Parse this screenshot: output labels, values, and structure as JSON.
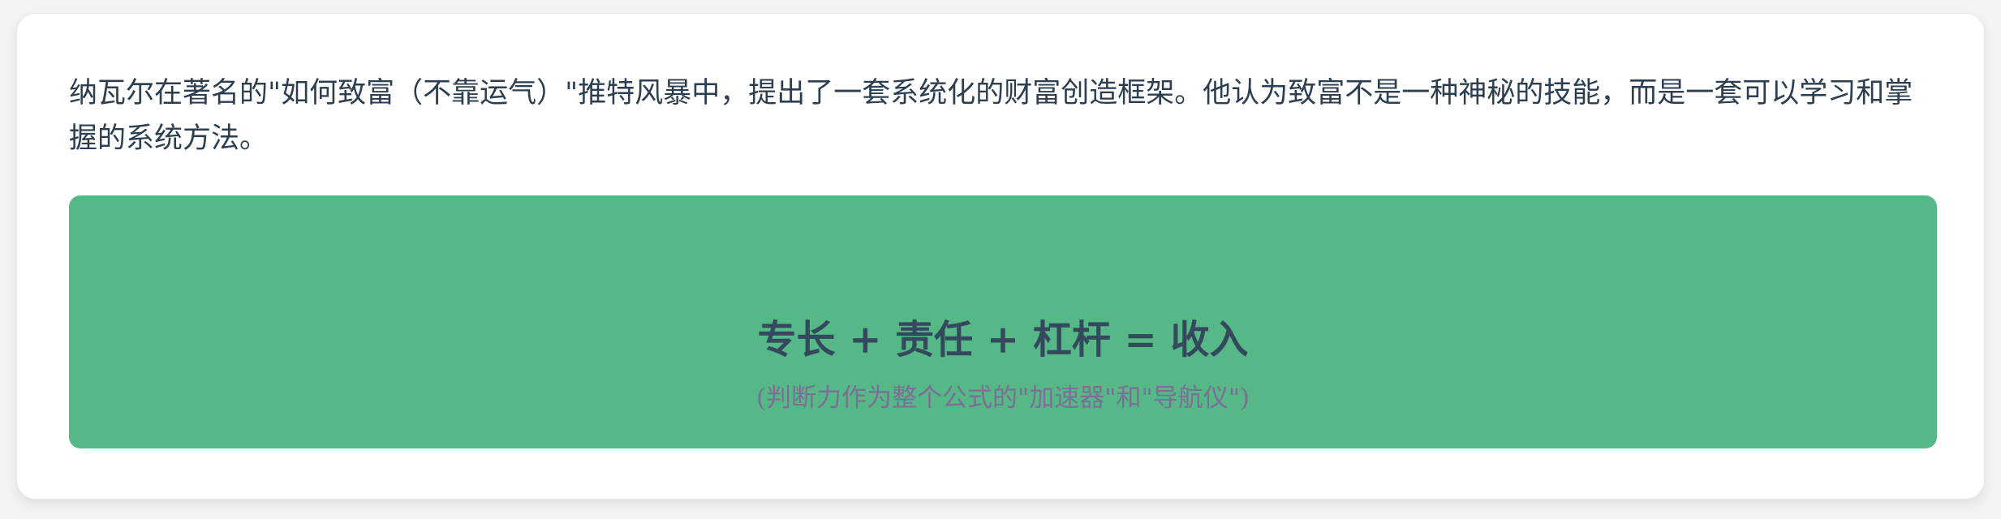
{
  "intro": {
    "text": "纳瓦尔在著名的\"如何致富（不靠运气）\"推特风暴中，提出了一套系统化的财富创造框架。他认为致富不是一种神秘的技能，而是一套可以学习和掌握的系统方法。"
  },
  "formula_box": {
    "formula": "专长 + 责任 + 杠杆 = 收入",
    "note": "(判断力作为整个公式的\"加速器\"和\"导航仪\")",
    "background_color": "#56b886",
    "formula_color": "#34495e",
    "note_color": "#7b6f97"
  }
}
